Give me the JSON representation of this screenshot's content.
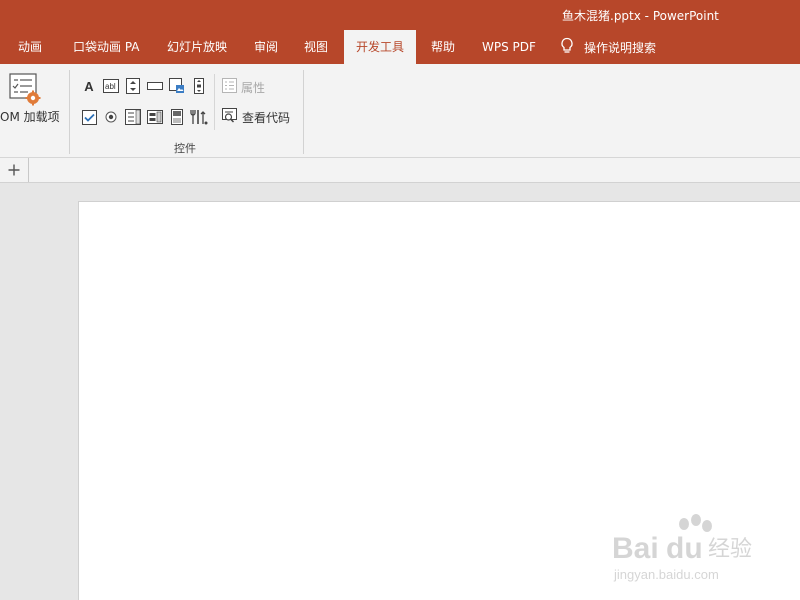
{
  "window": {
    "title": "鱼木混猪.pptx  -  PowerPoint"
  },
  "tabs": [
    {
      "label": "动画"
    },
    {
      "label": "口袋动画 PA"
    },
    {
      "label": "幻灯片放映"
    },
    {
      "label": "审阅"
    },
    {
      "label": "视图"
    },
    {
      "label": "开发工具",
      "active": true
    },
    {
      "label": "帮助"
    },
    {
      "label": "WPS PDF"
    }
  ],
  "tell_me": {
    "label": "操作说明搜索",
    "icon": "lightbulb-icon"
  },
  "ribbon": {
    "com_addins": {
      "label": "OM 加载项",
      "icon": "com-addins-icon"
    },
    "controls": {
      "label_glyph": "A",
      "properties_label": "属性",
      "view_code_label": "查看代码",
      "group_label": "控件"
    }
  },
  "section_bar": {
    "add_icon": "plus-icon"
  },
  "colors": {
    "accent": "#b7472a",
    "ribbon_bg": "#f3f3f3",
    "workspace_bg": "#e6e6e6",
    "slide_bg": "#ffffff"
  },
  "watermark": {
    "text": "Baidu经验",
    "url_text": "jingyan.baidu.com"
  }
}
